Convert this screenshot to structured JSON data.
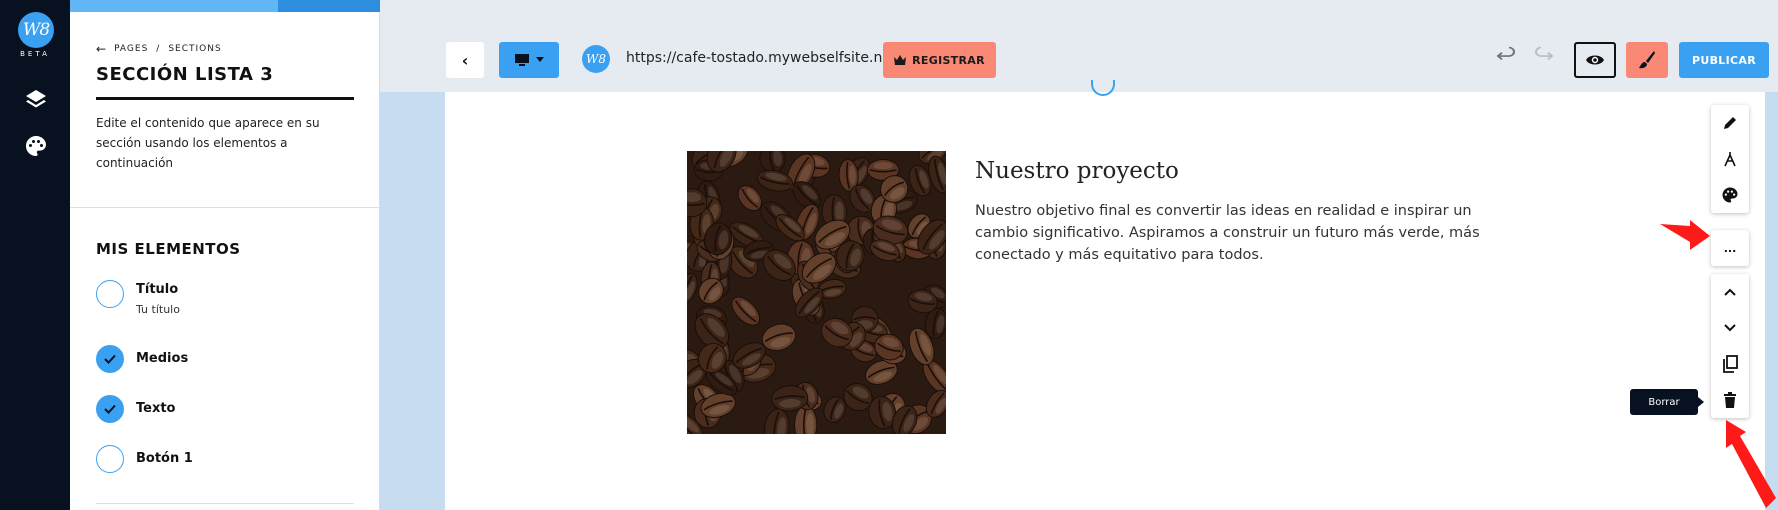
{
  "rail": {
    "logo_text": "W8",
    "beta_label": "BETA",
    "items": [
      {
        "icon": "layers-icon"
      },
      {
        "icon": "palette-icon"
      }
    ]
  },
  "panel": {
    "progress_fraction": 0.67,
    "breadcrumb": {
      "back_icon": "arrow-left-icon",
      "pages": "PAGES",
      "separator": "/",
      "sections": "SECTIONS"
    },
    "title": "SECCIÓN LISTA 3",
    "description": "Edite el contenido que aparece en su sección usando los elementos a continuación",
    "elements_title": "MIS ELEMENTOS",
    "elements": [
      {
        "label": "Título",
        "sublabel": "Tu título",
        "checked": false
      },
      {
        "label": "Medios",
        "sublabel": "",
        "checked": true
      },
      {
        "label": "Texto",
        "sublabel": "",
        "checked": true
      },
      {
        "label": "Botón 1",
        "sublabel": "",
        "checked": false
      }
    ]
  },
  "toolbar": {
    "back_icon": "chevron-left-icon",
    "device_icon": "desktop-icon",
    "url": "https://cafe-tostado.mywebselfsite.net",
    "register_label": "REGISTRAR",
    "register_icon": "crown-icon",
    "publish_label": "PUBLICAR",
    "preview_icon": "eye-icon",
    "design_icon": "brush-icon"
  },
  "content": {
    "title": "Nuestro proyecto",
    "text": "Nuestro objetivo final es convertir las ideas en realidad e inspirar un cambio significativo. Aspiramos a construir un futuro más verde, más conectado y más equitativo para todos.",
    "image": "coffee-beans-photo"
  },
  "section_tools": {
    "group1": [
      "pencil-icon",
      "compass-icon",
      "palette-icon"
    ],
    "more_label": "...",
    "group3": [
      "chevron-up-icon",
      "chevron-down-icon",
      "copy-icon",
      "trash-icon"
    ],
    "tooltip": "Borrar"
  },
  "colors": {
    "accent": "#3aa1f2",
    "coral": "#f98874",
    "dark": "#07111f",
    "canvas_bg": "#c5dcf1"
  }
}
